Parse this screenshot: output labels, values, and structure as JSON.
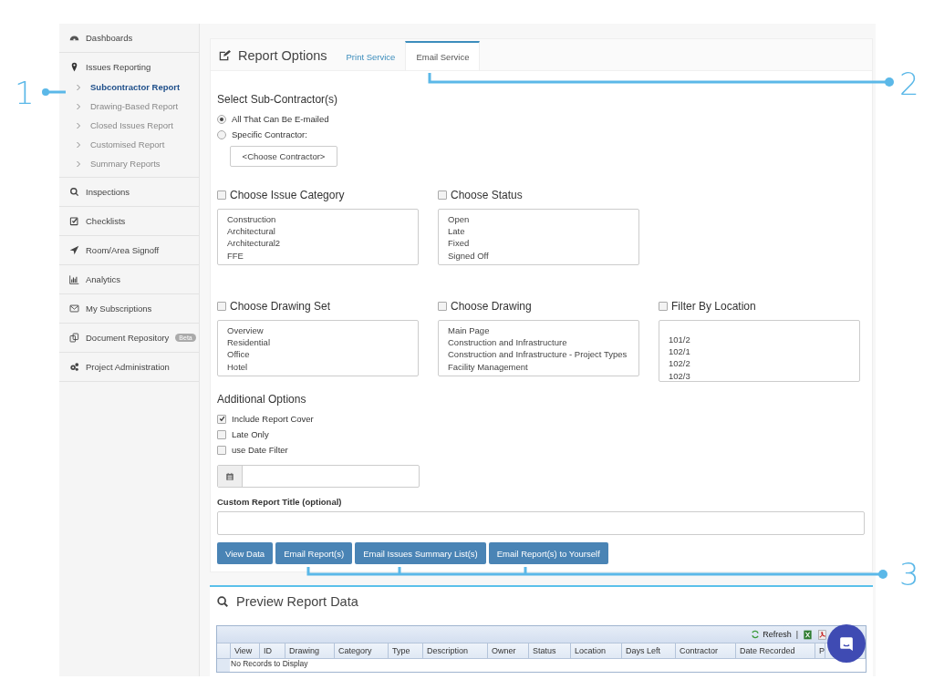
{
  "sidebar": {
    "items": [
      {
        "label": "Dashboards"
      },
      {
        "label": "Issues Reporting",
        "children": [
          {
            "label": "Subcontractor Report",
            "selected": true
          },
          {
            "label": "Drawing-Based Report",
            "selected": false
          },
          {
            "label": "Closed Issues Report",
            "selected": false
          },
          {
            "label": "Customised Report",
            "selected": false
          },
          {
            "label": "Summary Reports",
            "selected": false
          }
        ]
      },
      {
        "label": "Inspections"
      },
      {
        "label": "Checklists"
      },
      {
        "label": "Room/Area Signoff"
      },
      {
        "label": "Analytics"
      },
      {
        "label": "My Subscriptions"
      },
      {
        "label": "Document Repository",
        "badge": "Beta"
      },
      {
        "label": "Project Administration"
      }
    ]
  },
  "report_options": {
    "title": "Report Options",
    "tabs": [
      {
        "label": "Print Service",
        "selected": false
      },
      {
        "label": "Email Service",
        "selected": true
      }
    ],
    "sub_contractor": {
      "heading": "Select Sub-Contractor(s)",
      "options": [
        {
          "label": "All That Can Be E-mailed",
          "selected": true
        },
        {
          "label": "Specific Contractor:",
          "selected": false
        }
      ],
      "contractor_button": "<Choose Contractor>"
    },
    "filters": [
      {
        "heading": "Choose Issue Category",
        "checked": false,
        "items": [
          "Construction",
          "Architectural",
          "Architectural2",
          "FFE"
        ]
      },
      {
        "heading": "Choose Status",
        "checked": false,
        "items": [
          "Open",
          "Late",
          "Fixed",
          "Signed Off"
        ]
      },
      {
        "heading": "Choose Drawing Set",
        "checked": false,
        "items": [
          "Overview",
          "Residential",
          "Office",
          "Hotel"
        ]
      },
      {
        "heading": "Choose Drawing",
        "checked": false,
        "items": [
          "Main Page",
          "Construction and Infrastructure",
          "Construction and Infrastructure - Project Types",
          "Facility Management"
        ]
      },
      {
        "heading": "Filter By Location",
        "checked": false,
        "items": [
          "101/2",
          "102/1",
          "102/2",
          "102/3"
        ]
      }
    ],
    "additional_options": {
      "heading": "Additional Options",
      "options": [
        {
          "label": "Include Report Cover",
          "checked": true
        },
        {
          "label": "Late Only",
          "checked": false
        },
        {
          "label": "use Date Filter",
          "checked": false
        }
      ]
    },
    "custom_title_label": "Custom Report Title (optional)",
    "buttons": [
      "View Data",
      "Email Report(s)",
      "Email Issues Summary List(s)",
      "Email Report(s) to Yourself"
    ]
  },
  "preview": {
    "title": "Preview Report Data",
    "toolbar": {
      "refresh": "Refresh",
      "separator": "|"
    },
    "columns": [
      "View",
      "ID",
      "Drawing",
      "Category",
      "Type",
      "Description",
      "Owner",
      "Status",
      "Location",
      "Days Left",
      "Contractor",
      "Date Recorded",
      "P"
    ],
    "empty_message": "No Records to Display"
  },
  "callouts": [
    {
      "number": "1"
    },
    {
      "number": "2"
    },
    {
      "number": "3"
    }
  ]
}
